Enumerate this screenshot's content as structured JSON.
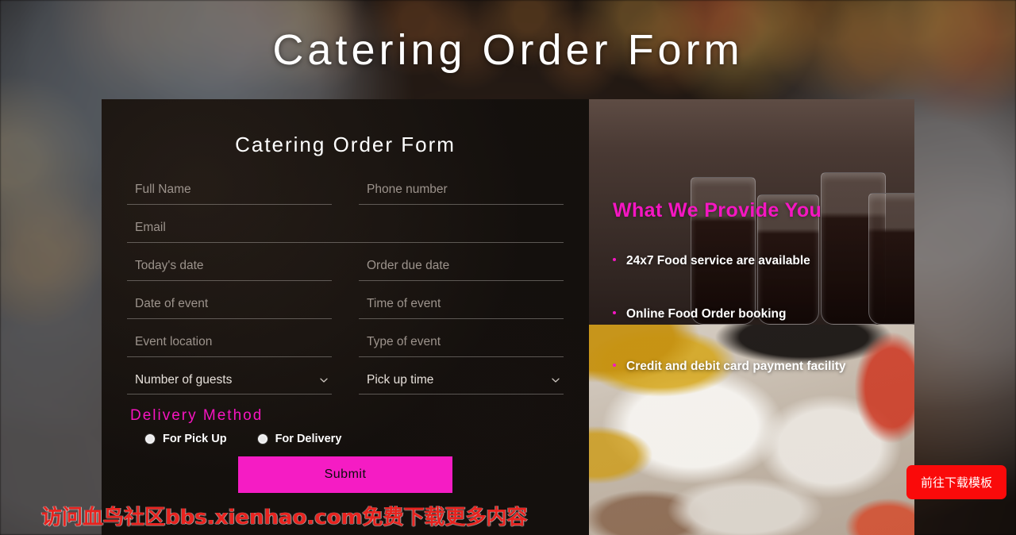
{
  "header": {
    "title": "Catering Order Form"
  },
  "form": {
    "title": "Catering Order Form",
    "fields": [
      {
        "name": "full-name",
        "placeholder": "Full Name",
        "value": ""
      },
      {
        "name": "phone-number",
        "placeholder": "Phone number",
        "value": ""
      },
      {
        "name": "email",
        "placeholder": "Email",
        "value": ""
      },
      {
        "name": "todays-date",
        "placeholder": "Today's date",
        "value": ""
      },
      {
        "name": "order-due-date",
        "placeholder": "Order due date",
        "value": ""
      },
      {
        "name": "date-of-event",
        "placeholder": "Date of event",
        "value": ""
      },
      {
        "name": "time-of-event",
        "placeholder": "Time of event",
        "value": ""
      },
      {
        "name": "event-location",
        "placeholder": "Event location",
        "value": ""
      },
      {
        "name": "type-of-event",
        "placeholder": "Type of event",
        "value": ""
      }
    ],
    "selects": [
      {
        "name": "number-of-guests",
        "label": "Number of guests"
      },
      {
        "name": "pick-up-time",
        "label": "Pick up time"
      }
    ],
    "delivery": {
      "heading": "Delivery Method",
      "options": [
        {
          "label": "For Pick Up",
          "selected": false
        },
        {
          "label": "For Delivery",
          "selected": false
        }
      ]
    },
    "submit_label": "Submit"
  },
  "promo": {
    "heading": "What We Provide You",
    "items": [
      "24x7 Food service are available",
      "Online Food Order booking",
      "Credit and debit card payment facility"
    ]
  },
  "overlay": {
    "watermark": "访问血鸟社区bbs.xienhao.com免费下载更多内容",
    "download_label": "前往下载模板"
  },
  "colors": {
    "accent_pink": "#f516c2",
    "submit_pink": "#f51cc4",
    "watermark_red": "#e8231f",
    "download_red": "#fa0a0a"
  }
}
